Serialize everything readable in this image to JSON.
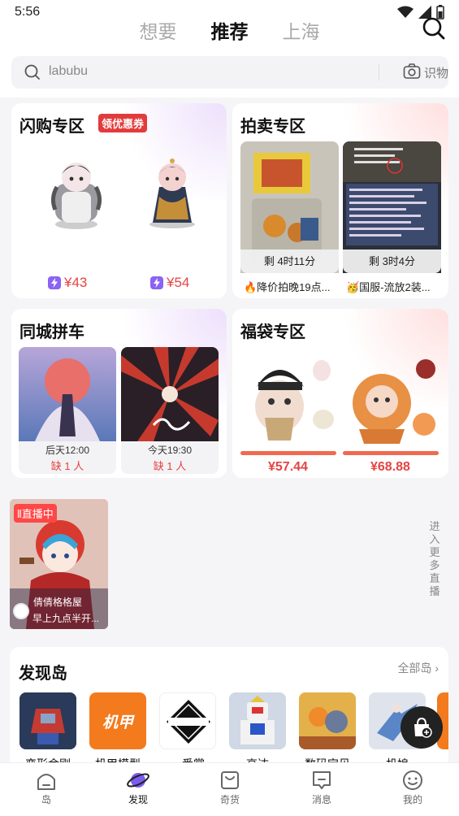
{
  "status": {
    "time": "5:56"
  },
  "tabs": [
    {
      "label": "想要"
    },
    {
      "label": "推荐"
    },
    {
      "label": "上海"
    }
  ],
  "search": {
    "placeholder": "labubu",
    "camera_label": "识物"
  },
  "flash": {
    "title": "闪购专区",
    "coupon_label": "领优惠券",
    "items": [
      {
        "price": "¥43"
      },
      {
        "price": "¥54"
      }
    ]
  },
  "auction": {
    "title": "拍卖专区",
    "items": [
      {
        "timer": "剩 4时11分",
        "caption": "🔥降价拍晚19点..."
      },
      {
        "timer": "剩 3时4分",
        "caption": "🥳国服-流放2装..."
      }
    ]
  },
  "carpool": {
    "title": "同城拼车",
    "items": [
      {
        "time": "后天12:00",
        "lack": "缺 1 人"
      },
      {
        "time": "今天19:30",
        "lack": "缺 1 人"
      }
    ]
  },
  "luckybag": {
    "title": "福袋专区",
    "items": [
      {
        "price": "¥57.44"
      },
      {
        "price": "¥68.88"
      }
    ]
  },
  "live": {
    "badge": "直播中",
    "line1": "倩倩格格屋",
    "line2": "早上九点半开...",
    "enter_label": "进入更多直播"
  },
  "island": {
    "title": "发现岛",
    "all_label": "全部岛",
    "items": [
      {
        "label": "变形金刚"
      },
      {
        "label": "机甲模型"
      },
      {
        "label": "一番赏"
      },
      {
        "label": "高达"
      },
      {
        "label": "数码宝贝"
      },
      {
        "label": "机娘"
      }
    ]
  },
  "nav": [
    {
      "label": "岛"
    },
    {
      "label": "发现"
    },
    {
      "label": "奇货"
    },
    {
      "label": "消息"
    },
    {
      "label": "我的"
    }
  ],
  "colors": {
    "price_red": "#e64343",
    "flash_purple": "#8b63f5",
    "bag_orange": "#f06a50"
  }
}
